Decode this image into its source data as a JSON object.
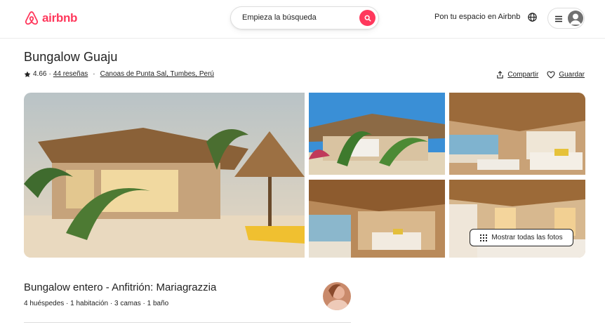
{
  "header": {
    "logo_text": "airbnb",
    "search_placeholder": "Empieza la búsqueda",
    "host_link": "Pon tu espacio en Airbnb",
    "brand_color": "#ff385c"
  },
  "listing": {
    "title": "Bungalow Guaju",
    "rating": "4.66",
    "separator": "·",
    "reviews": "44 reseñas",
    "location": "Canoas de Punta Sal, Tumbes, Perú",
    "share": "Compartir",
    "save": "Guardar"
  },
  "gallery": {
    "show_all": "Mostrar todas las fotos"
  },
  "summary": {
    "title": "Bungalow entero - Anfitrión: Mariagrazzia",
    "details": "4 huéspedes · 1 habitación · 3 camas · 1 baño"
  },
  "icons": {
    "logo": "airbnb-logo-icon",
    "search": "search-icon",
    "globe": "globe-icon",
    "menu": "menu-icon",
    "user": "user-icon",
    "star": "star-icon",
    "share": "share-icon",
    "heart": "heart-icon",
    "grid": "grid-icon"
  }
}
